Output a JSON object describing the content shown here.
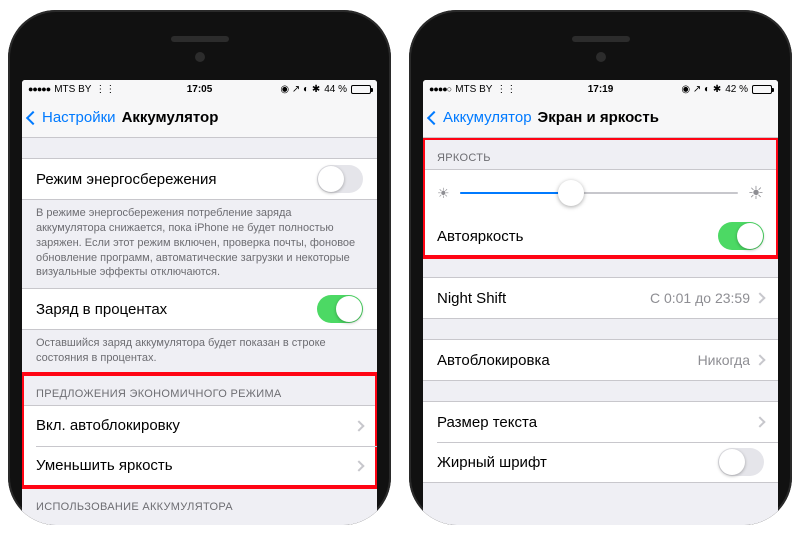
{
  "left": {
    "status": {
      "carrier": "MTS BY",
      "time": "17:05",
      "battery_text": "44 %",
      "battery_pct": 44,
      "wifi": "◉"
    },
    "nav": {
      "back": "Настройки",
      "title": "Аккумулятор"
    },
    "power_mode": {
      "label": "Режим энергосбережения",
      "on": false
    },
    "power_mode_footer": "В режиме энергосбережения потребление заряда аккумулятора снижается, пока iPhone не будет полностью заряжен. Если этот режим включен, проверка почты, фоновое обновление программ, автоматические загрузки и некоторые визуальные эффекты отключаются.",
    "percent": {
      "label": "Заряд в процентах",
      "on": true
    },
    "percent_footer": "Оставшийся заряд аккумулятора будет показан в строке состояния в процентах.",
    "suggestions_header": "ПРЕДЛОЖЕНИЯ ЭКОНОМИЧНОГО РЕЖИМА",
    "suggestions": [
      {
        "label": "Вкл. автоблокировку"
      },
      {
        "label": "Уменьшить яркость"
      }
    ],
    "usage_header": "ИСПОЛЬЗОВАНИЕ АККУМУЛЯТОРА"
  },
  "right": {
    "status": {
      "carrier": "MTS BY",
      "time": "17:19",
      "battery_text": "42 %",
      "battery_pct": 42
    },
    "nav": {
      "back": "Аккумулятор",
      "title": "Экран и яркость"
    },
    "brightness_header": "ЯРКОСТЬ",
    "brightness_pct": 40,
    "auto_brightness": {
      "label": "Автояркость",
      "on": true
    },
    "night_shift": {
      "label": "Night Shift",
      "value": "С 0:01 до 23:59"
    },
    "autolock": {
      "label": "Автоблокировка",
      "value": "Никогда"
    },
    "text_size": {
      "label": "Размер текста"
    },
    "bold_text": {
      "label": "Жирный шрифт",
      "on": false
    }
  }
}
